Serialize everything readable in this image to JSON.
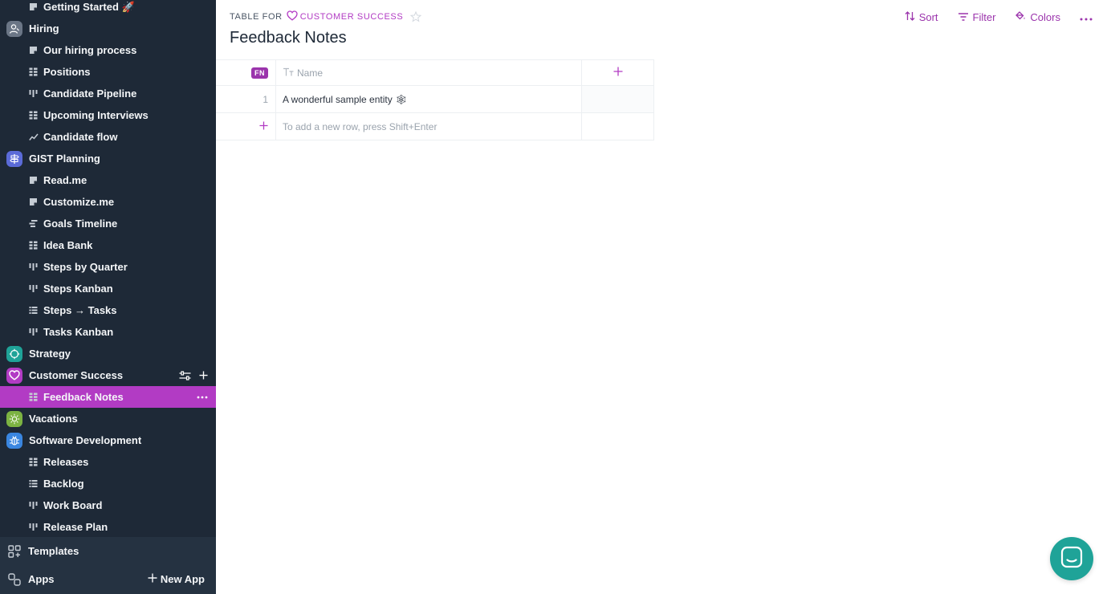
{
  "sidebar": {
    "items": [
      {
        "type": "child",
        "icon": "document-icon",
        "label": "Getting Started 🚀"
      },
      {
        "type": "app",
        "icon": "person-icon",
        "color": "#6b7686",
        "label": "Hiring"
      },
      {
        "type": "child",
        "icon": "document-icon",
        "label": "Our hiring process"
      },
      {
        "type": "child",
        "icon": "table-icon",
        "label": "Positions"
      },
      {
        "type": "child",
        "icon": "kanban-icon",
        "label": "Candidate Pipeline"
      },
      {
        "type": "child",
        "icon": "table-icon",
        "label": "Upcoming Interviews"
      },
      {
        "type": "child",
        "icon": "chart-line-icon",
        "label": "Candidate flow"
      },
      {
        "type": "app",
        "icon": "signpost-icon",
        "color": "#5b6bd8",
        "label": "GIST Planning"
      },
      {
        "type": "child",
        "icon": "document-icon",
        "label": "Read.me"
      },
      {
        "type": "child",
        "icon": "document-icon",
        "label": "Customize.me"
      },
      {
        "type": "child",
        "icon": "timeline-icon",
        "label": "Goals Timeline"
      },
      {
        "type": "child",
        "icon": "table-icon",
        "label": "Idea Bank"
      },
      {
        "type": "child",
        "icon": "kanban-icon",
        "label": "Steps by Quarter"
      },
      {
        "type": "child",
        "icon": "kanban-icon",
        "label": "Steps Kanban"
      },
      {
        "type": "child",
        "icon": "list-icon",
        "label": "Steps → Tasks"
      },
      {
        "type": "child",
        "icon": "kanban-icon",
        "label": "Tasks Kanban"
      },
      {
        "type": "app",
        "icon": "target-icon",
        "color": "#1fa398",
        "label": "Strategy"
      },
      {
        "type": "app",
        "icon": "heart-icon",
        "color": "#b23bc4",
        "label": "Customer Success",
        "actions": [
          "sliders-icon",
          "plus-icon"
        ]
      },
      {
        "type": "child",
        "icon": "table-icon",
        "label": "Feedback Notes",
        "selected": true,
        "actions": [
          "more-icon"
        ]
      },
      {
        "type": "app",
        "icon": "sun-icon",
        "color": "#7cb342",
        "label": "Vacations"
      },
      {
        "type": "app",
        "icon": "bug-icon",
        "color": "#3a86e0",
        "label": "Software Development"
      },
      {
        "type": "child",
        "icon": "table-icon",
        "label": "Releases"
      },
      {
        "type": "child",
        "icon": "list-icon",
        "label": "Backlog"
      },
      {
        "type": "child",
        "icon": "kanban-icon",
        "label": "Work Board"
      },
      {
        "type": "child",
        "icon": "kanban-icon",
        "label": "Release Plan"
      }
    ],
    "footer": {
      "templates_label": "Templates",
      "apps_label": "Apps",
      "new_app_label": "New App"
    }
  },
  "header": {
    "crumb_prefix": "TABLE FOR",
    "crumb_app": "CUSTOMER SUCCESS",
    "title": "Feedback Notes",
    "toolbar": {
      "sort_label": "Sort",
      "filter_label": "Filter",
      "colors_label": "Colors"
    }
  },
  "table": {
    "badge": "FN",
    "columns": [
      {
        "icon": "text-type-icon",
        "label": "Name"
      }
    ],
    "rows": [
      {
        "num": "1",
        "name": "A wonderful sample entity 🕸"
      }
    ],
    "add_row_hint": "To add a new row, press Shift+Enter"
  },
  "colors": {
    "accent": "#b23bc4",
    "sidebar_bg": "#1e2937",
    "chat_button": "#1fa398"
  }
}
